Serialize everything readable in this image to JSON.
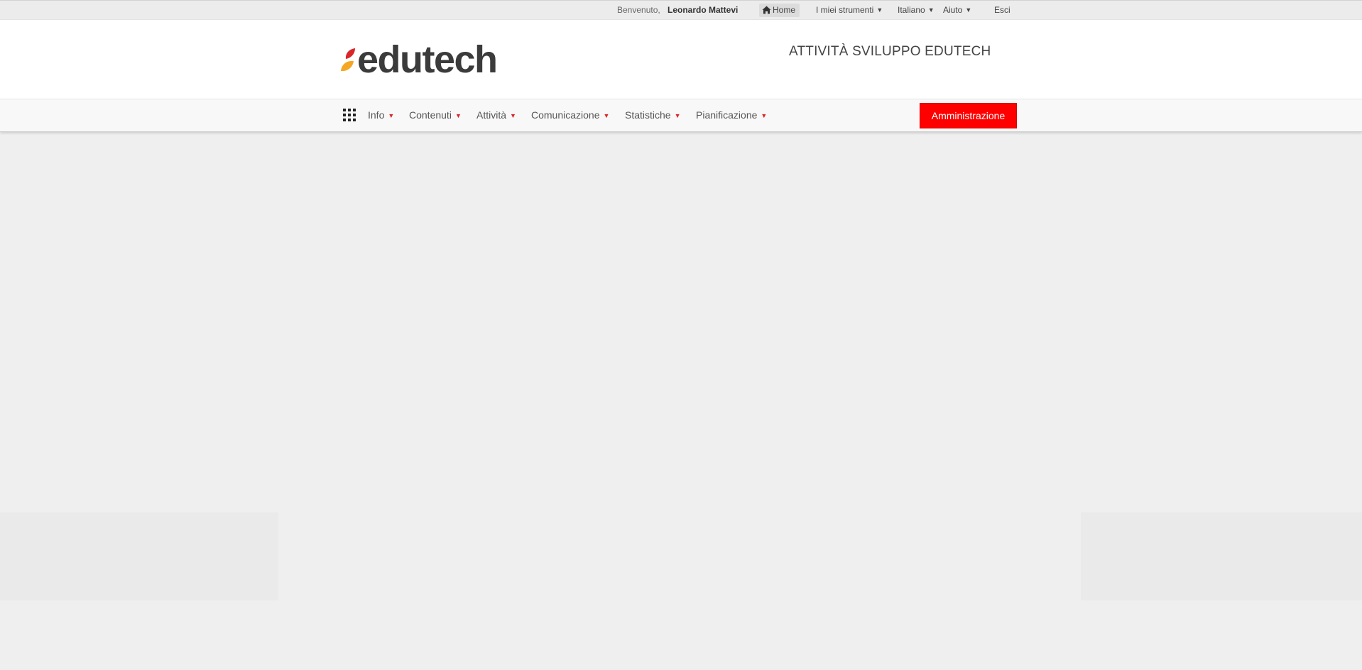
{
  "topbar": {
    "welcome": "Benvenuto,",
    "user_name": "Leonardo Mattevi",
    "home_label": "Home",
    "home_icon": "home-icon",
    "tools_label": "I miei strumenti",
    "language_label": "Italiano",
    "help_label": "Aiuto",
    "logout_label": "Esci"
  },
  "header": {
    "logo_text": "edutech",
    "site_title": "ATTIVITÀ SVILUPPO EDUTECH"
  },
  "nav": {
    "apps_icon": "grid-icon",
    "items": [
      {
        "label": "Info"
      },
      {
        "label": "Contenuti"
      },
      {
        "label": "Attività"
      },
      {
        "label": "Comunicazione"
      },
      {
        "label": "Statistiche"
      },
      {
        "label": "Pianificazione"
      }
    ],
    "admin_label": "Amministrazione"
  },
  "colors": {
    "accent_red": "#ff0000",
    "caret_red": "#d9262b",
    "logo_leaf_red": "#d9262b",
    "logo_leaf_orange": "#f5a623",
    "background": "#efefef"
  }
}
